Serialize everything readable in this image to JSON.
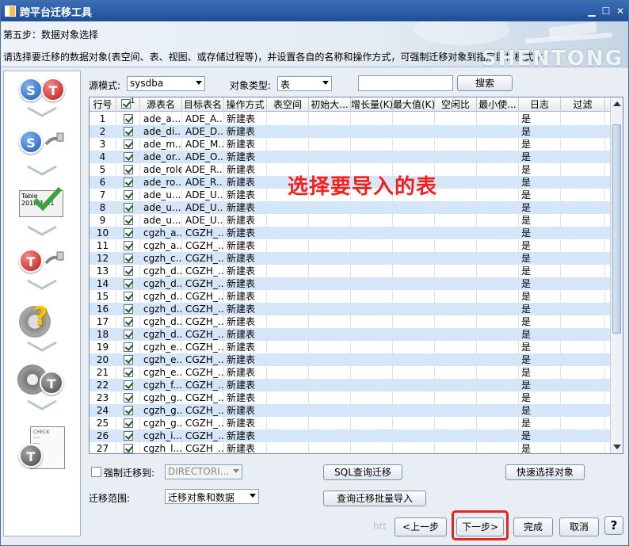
{
  "window": {
    "title": "跨平台迁移工具",
    "controls": [
      "minimize-icon",
      "maximize-icon",
      "close-icon"
    ]
  },
  "header": {
    "step": "第五步：数据对象选择",
    "description": "请选择要迁移的数据对象(表空间、表、视图、或存储过程等)，并设置各自的名称和操作方式，可强制迁移对象到指定目标模式中。",
    "logo": "SHENTONG"
  },
  "sidebar": {
    "icons": [
      "source-to-target-icon",
      "source-connect-icon",
      "table-check-icon",
      "target-connect-icon",
      "config-question-icon",
      "settings-target-icon",
      "checklist-target-icon"
    ]
  },
  "filters": {
    "source_label": "源模式:",
    "source_value": "sysdba",
    "type_label": "对象类型:",
    "type_value": "表",
    "search_value": "",
    "search_button": "搜索"
  },
  "grid": {
    "columns": [
      "行号",
      "",
      "源表名",
      "目标表名",
      "操作方式",
      "表空间",
      "初始大...",
      "增长量(K)",
      "最大值(K)",
      "空闲比",
      "最小使...",
      "日志",
      "过滤"
    ],
    "header_checkbox_num": "1",
    "rows": [
      [
        "1",
        "ade_a...",
        "ADE_A...",
        "新建表",
        "是"
      ],
      [
        "2",
        "ade_di...",
        "ADE_D...",
        "新建表",
        "是"
      ],
      [
        "3",
        "ade_m...",
        "ADE_M...",
        "新建表",
        "是"
      ],
      [
        "4",
        "ade_or...",
        "ADE_O...",
        "新建表",
        "是"
      ],
      [
        "5",
        "ade_role",
        "ADE_R...",
        "新建表",
        "是"
      ],
      [
        "6",
        "ade_ro...",
        "ADE_R...",
        "新建表",
        "是"
      ],
      [
        "7",
        "ade_u...",
        "ADE_U...",
        "新建表",
        "是"
      ],
      [
        "8",
        "ade_u...",
        "ADE_U...",
        "新建表",
        "是"
      ],
      [
        "9",
        "ade_u...",
        "ADE_U...",
        "新建表",
        "是"
      ],
      [
        "10",
        "cgzh_a...",
        "CGZH_...",
        "新建表",
        "是"
      ],
      [
        "11",
        "cgzh_a...",
        "CGZH_...",
        "新建表",
        "是"
      ],
      [
        "12",
        "cgzh_c...",
        "CGZH_...",
        "新建表",
        "是"
      ],
      [
        "13",
        "cgzh_d...",
        "CGZH_...",
        "新建表",
        "是"
      ],
      [
        "14",
        "cgzh_d...",
        "CGZH_...",
        "新建表",
        "是"
      ],
      [
        "15",
        "cgzh_d...",
        "CGZH_...",
        "新建表",
        "是"
      ],
      [
        "16",
        "cgzh_d...",
        "CGZH_...",
        "新建表",
        "是"
      ],
      [
        "17",
        "cgzh_d...",
        "CGZH_...",
        "新建表",
        "是"
      ],
      [
        "18",
        "cgzh_d...",
        "CGZH_...",
        "新建表",
        "是"
      ],
      [
        "19",
        "cgzh_e...",
        "CGZH_...",
        "新建表",
        "是"
      ],
      [
        "20",
        "cgzh_e...",
        "CGZH_...",
        "新建表",
        "是"
      ],
      [
        "21",
        "cgzh_e...",
        "CGZH_...",
        "新建表",
        "是"
      ],
      [
        "22",
        "cgzh_f...",
        "CGZH_...",
        "新建表",
        "是"
      ],
      [
        "23",
        "cgzh_g...",
        "CGZH_...",
        "新建表",
        "是"
      ],
      [
        "24",
        "cgzh_g...",
        "CGZH_...",
        "新建表",
        "是"
      ],
      [
        "25",
        "cgzh_g...",
        "CGZH_...",
        "新建表",
        "是"
      ],
      [
        "26",
        "cgzh_i...",
        "CGZH_...",
        "新建表",
        "是"
      ],
      [
        "27",
        "cgzh_l...",
        "CGZH_...",
        "新建表",
        "是"
      ]
    ]
  },
  "annotation": "选择要导入的表",
  "options": {
    "force_migrate_label": "强制迁移到:",
    "force_target_value": "DIRECTORI...",
    "sql_query_button": "SQL查询迁移",
    "quick_select_button": "快速选择对象",
    "scope_label": "迁移范围:",
    "scope_value": "迁移对象和数据",
    "batch_import_button": "查询迁移批量导入"
  },
  "footer": {
    "watermark": "htt",
    "prev_button": "<上一步",
    "next_button": "下一步>",
    "finish_button": "完成",
    "cancel_button": "取消",
    "help_button": "?"
  }
}
